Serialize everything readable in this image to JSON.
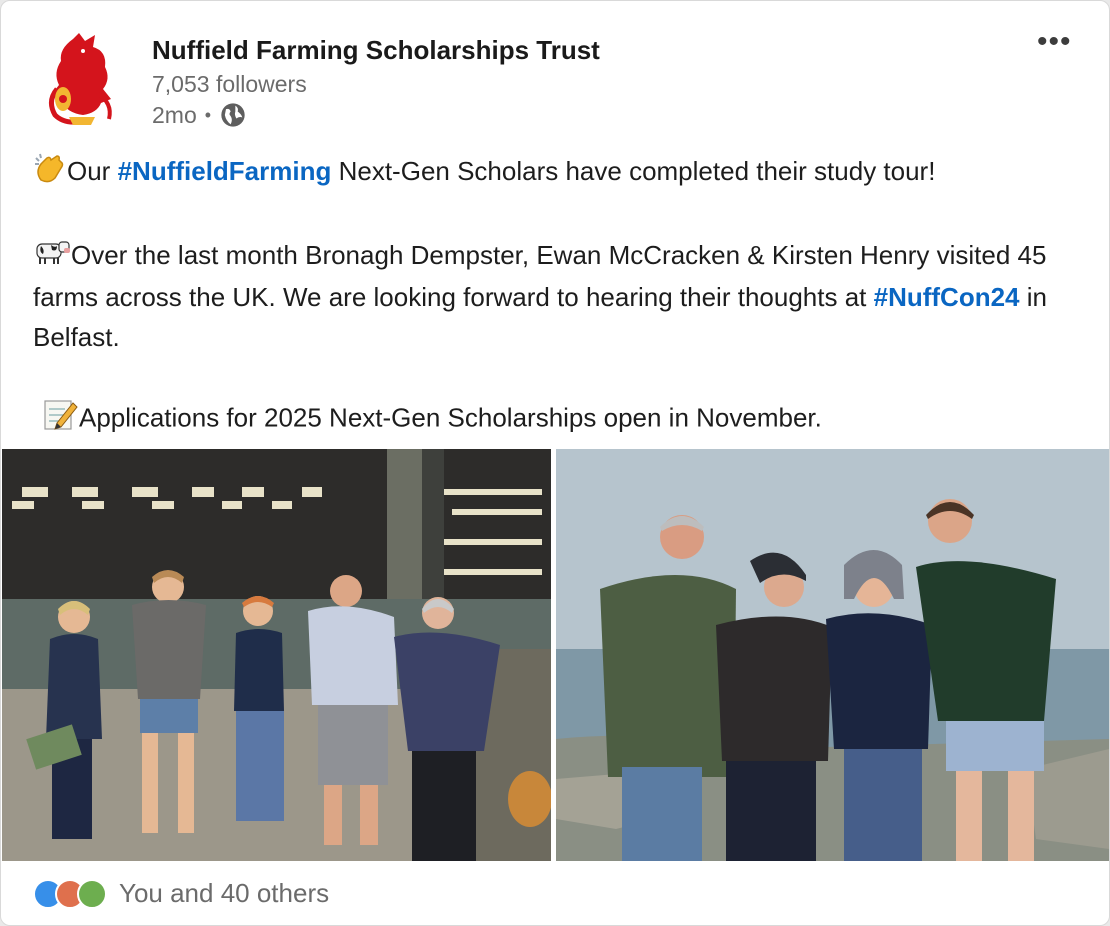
{
  "post": {
    "author": "Nuffield Farming Scholarships Trust",
    "followers": "7,053 followers",
    "time": "2mo",
    "visibility_icon": "globe-icon",
    "menu_icon": "more-icon",
    "line1_pre": "Our ",
    "line1_tag": "#NuffieldFarming",
    "line1_post": " Next-Gen Scholars have completed their study tour!",
    "para2_pre": "Over the last month Bronagh Dempster, Ewan McCracken & Kirsten Henry visited 45 farms across the UK. We are looking forward to hearing their thoughts at ",
    "para2_tag": "#NuffCon24",
    "para2_post": " in Belfast.",
    "para3": "Applications for 2025 Next-Gen Scholarships open in November.",
    "emoji": [
      "clapping-hands",
      "cow",
      "memo"
    ]
  },
  "reactions": {
    "text": "You and 40 others",
    "icons": [
      "like-icon",
      "love-icon",
      "celebrate-icon"
    ]
  },
  "colors": {
    "link": "#0a66c2",
    "muted": "#6b6b6b",
    "logo_red": "#d4141c"
  }
}
